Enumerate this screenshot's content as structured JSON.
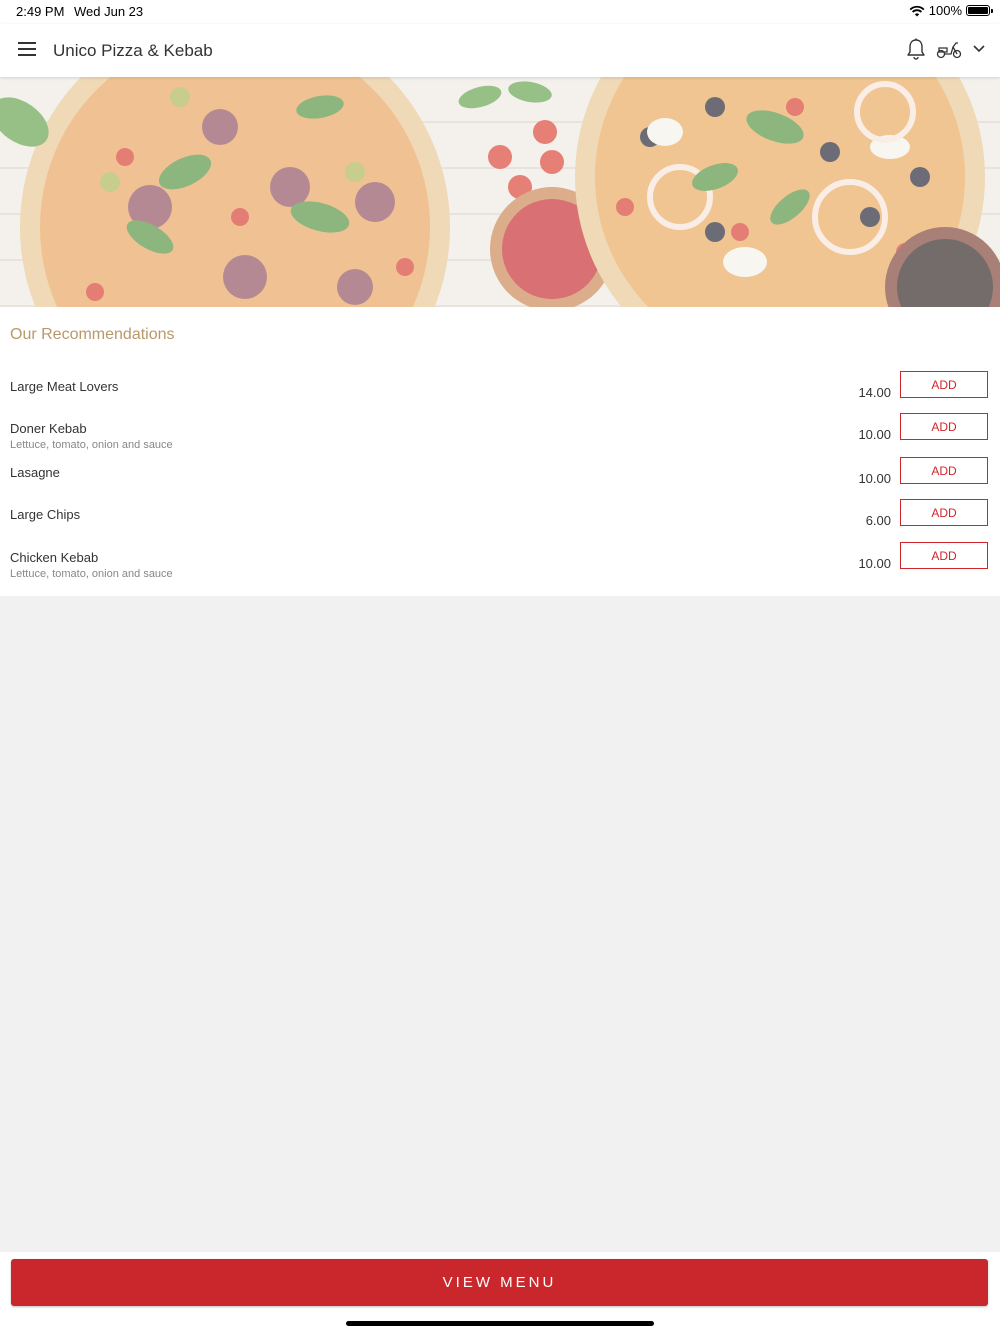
{
  "status_bar": {
    "time": "2:49 PM",
    "date": "Wed Jun 23",
    "battery": "100%"
  },
  "header": {
    "title": "Unico Pizza & Kebab",
    "icons": [
      "menu-icon",
      "bell-icon",
      "scooter-icon",
      "chevron-down-icon"
    ]
  },
  "recommendations": {
    "title": "Our Recommendations",
    "add_label": "ADD",
    "items": [
      {
        "name": "Large Meat Lovers",
        "description": "",
        "price": "14.00"
      },
      {
        "name": "Doner Kebab",
        "description": "Lettuce, tomato, onion and sauce",
        "price": "10.00"
      },
      {
        "name": "Lasagne",
        "description": "",
        "price": "10.00"
      },
      {
        "name": "Large Chips",
        "description": "",
        "price": "6.00"
      },
      {
        "name": "Chicken Kebab",
        "description": "Lettuce, tomato, onion and sauce",
        "price": "10.00"
      }
    ]
  },
  "footer": {
    "view_menu_label": "VIEW MENU"
  },
  "colors": {
    "accent": "#c9272b",
    "section_title": "#b8996b",
    "page_bg": "#f1f1f1"
  }
}
